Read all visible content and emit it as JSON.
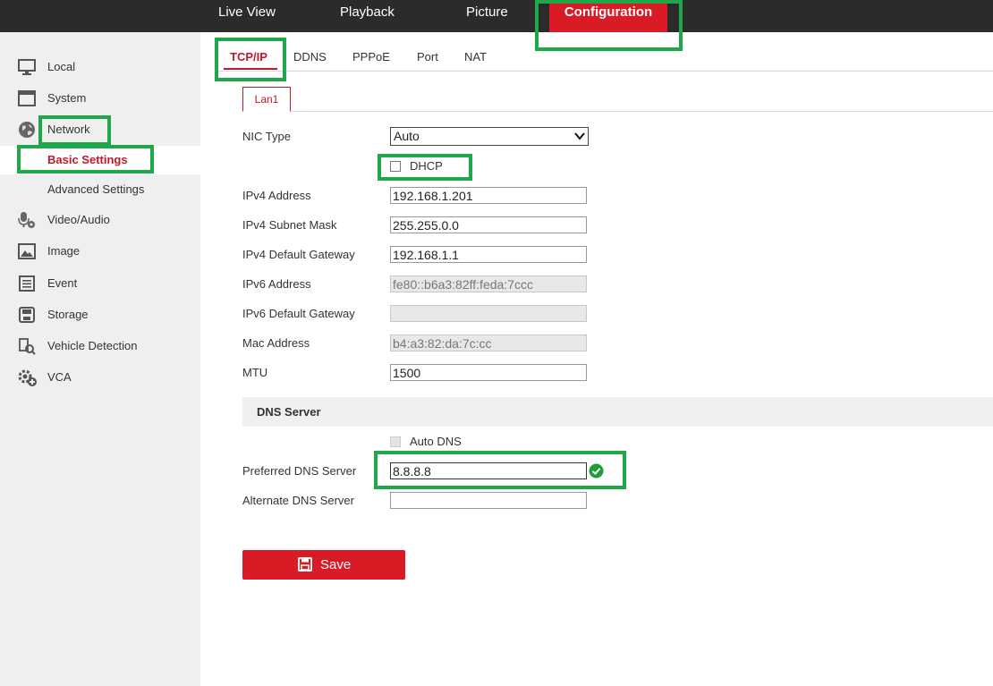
{
  "top_nav": {
    "items": [
      {
        "label": "Live View"
      },
      {
        "label": "Playback"
      },
      {
        "label": "Picture"
      },
      {
        "label": "Configuration"
      }
    ]
  },
  "sidebar": {
    "items": [
      {
        "label": "Local",
        "icon": "monitor-icon"
      },
      {
        "label": "System",
        "icon": "window-icon"
      },
      {
        "label": "Network",
        "icon": "globe-icon"
      },
      {
        "label": "Basic Settings"
      },
      {
        "label": "Advanced Settings"
      },
      {
        "label": "Video/Audio",
        "icon": "microphone-camera-icon"
      },
      {
        "label": "Image",
        "icon": "image-icon"
      },
      {
        "label": "Event",
        "icon": "event-list-icon"
      },
      {
        "label": "Storage",
        "icon": "storage-icon"
      },
      {
        "label": "Vehicle Detection",
        "icon": "vehicle-search-icon"
      },
      {
        "label": "VCA",
        "icon": "vca-gear-icon"
      }
    ]
  },
  "tabs": [
    "TCP/IP",
    "DDNS",
    "PPPoE",
    "Port",
    "NAT"
  ],
  "subtab": "Lan1",
  "form": {
    "nic_type_label": "NIC Type",
    "nic_type_value": "Auto",
    "dhcp_label": "DHCP",
    "ipv4_address_label": "IPv4 Address",
    "ipv4_address": "192.168.1.201",
    "ipv4_mask_label": "IPv4 Subnet Mask",
    "ipv4_mask": "255.255.0.0",
    "ipv4_gateway_label": "IPv4 Default Gateway",
    "ipv4_gateway": "192.168.1.1",
    "ipv6_address_label": "IPv6 Address",
    "ipv6_address": "fe80::b6a3:82ff:feda:7ccc",
    "ipv6_gateway_label": "IPv6 Default Gateway",
    "ipv6_gateway": "",
    "mac_label": "Mac Address",
    "mac": "b4:a3:82:da:7c:cc",
    "mtu_label": "MTU",
    "mtu": "1500"
  },
  "dns": {
    "section_title": "DNS Server",
    "auto_dns_label": "Auto DNS",
    "preferred_label": "Preferred DNS Server",
    "preferred": "8.8.8.8",
    "alternate_label": "Alternate DNS Server",
    "alternate": ""
  },
  "save_label": "Save",
  "colors": {
    "accent": "#d81b24",
    "highlight": "#1fa84a",
    "topbar": "#2b2b2b",
    "sidebar": "#efefef"
  }
}
